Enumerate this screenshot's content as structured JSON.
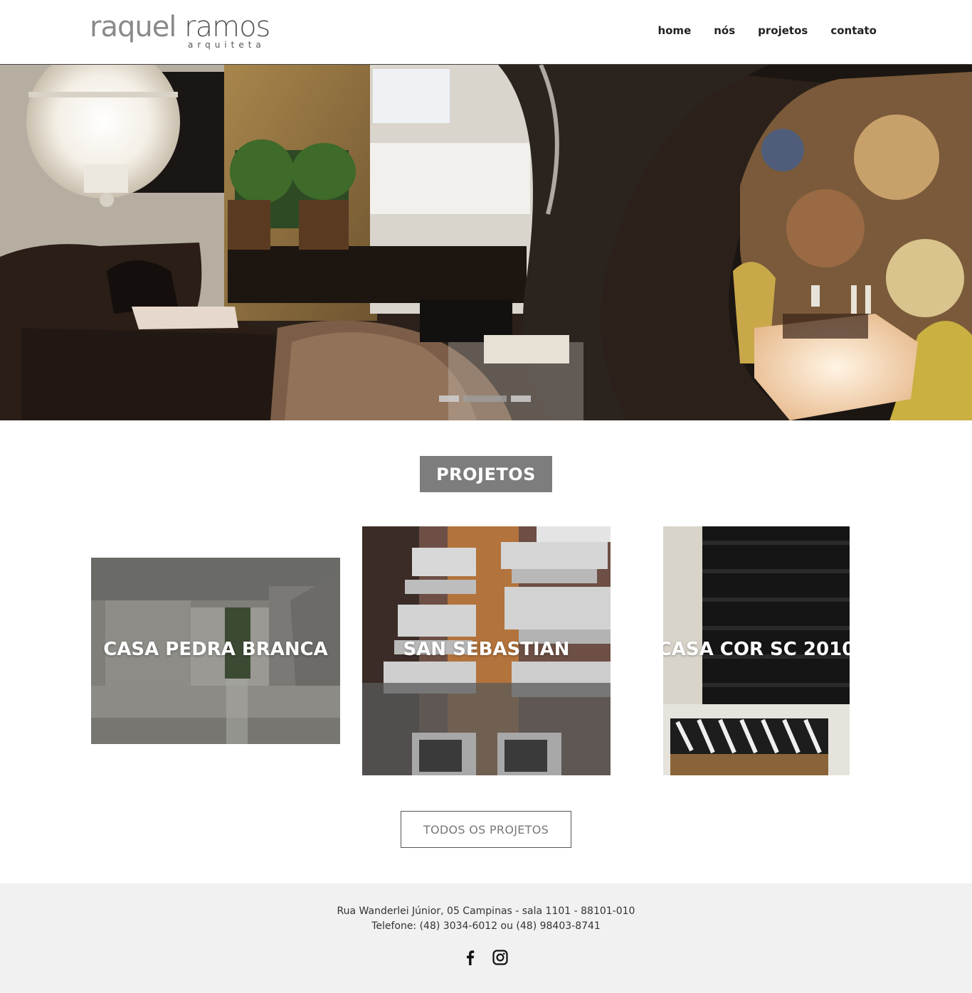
{
  "brand": {
    "name_first": "raquel",
    "name_last": "ramos",
    "subtitle": "arquiteta"
  },
  "nav": [
    {
      "label": "home"
    },
    {
      "label": "nós"
    },
    {
      "label": "projetos"
    },
    {
      "label": "contato"
    }
  ],
  "hero": {
    "slides_indicator": [
      "slide-1",
      "slide-2",
      "slide-3"
    ]
  },
  "projects": {
    "title": "PROJETOS",
    "items": [
      {
        "label": "CASA PEDRA BRANCA"
      },
      {
        "label": "SAN SEBASTIAN"
      },
      {
        "label": "CASA COR SC 2010"
      }
    ],
    "all_button": "TODOS OS PROJETOS"
  },
  "footer": {
    "address": "Rua Wanderlei Júnior, 05 Campinas - sala 1101 - 88101-010",
    "phone": "Telefone: (48) 3034-6012 ou (48) 98403-8741",
    "social_icons": [
      "facebook-icon",
      "instagram-icon"
    ]
  }
}
